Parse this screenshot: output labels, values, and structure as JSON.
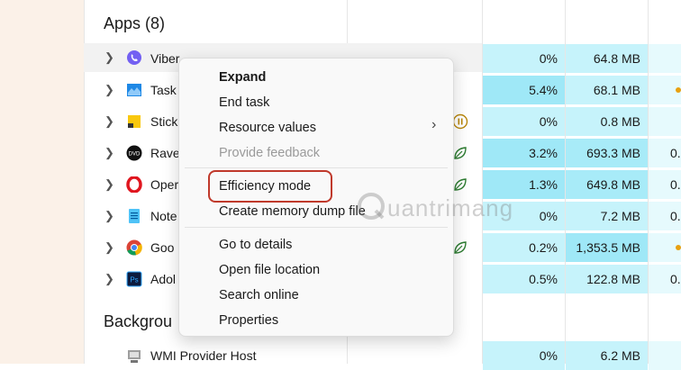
{
  "sections": {
    "apps_title": "Apps (8)",
    "background_title": "Backgrou"
  },
  "rows": [
    {
      "name": "Viber",
      "cpu": "0%",
      "mem": "64.8 MB",
      "extra": ""
    },
    {
      "name": "Task",
      "cpu": "5.4%",
      "mem": "68.1 MB",
      "extra": ""
    },
    {
      "name": "Stick",
      "cpu": "0%",
      "mem": "0.8 MB",
      "extra": ""
    },
    {
      "name": "Rave",
      "cpu": "3.2%",
      "mem": "693.3 MB",
      "extra": "0."
    },
    {
      "name": "Oper",
      "cpu": "1.3%",
      "mem": "649.8 MB",
      "extra": "0."
    },
    {
      "name": "Note",
      "cpu": "0%",
      "mem": "7.2 MB",
      "extra": "0."
    },
    {
      "name": "Goo",
      "cpu": "0.2%",
      "mem": "1,353.5 MB",
      "extra": ""
    },
    {
      "name": "Adol",
      "cpu": "0.5%",
      "mem": "122.8 MB",
      "extra": "0."
    }
  ],
  "background_rows": [
    {
      "name": "WMI Provider Host",
      "cpu": "0%",
      "mem": "6.2 MB",
      "extra": ""
    }
  ],
  "context_menu": {
    "items": [
      "Expand",
      "End task",
      "Resource values",
      "Provide feedback",
      "Efficiency mode",
      "Create memory dump file",
      "Go to details",
      "Open file location",
      "Search online",
      "Properties"
    ],
    "submenu_arrow": "›"
  },
  "watermark": "uantrimang",
  "colors": {
    "cpu_light": "#c6f3fb",
    "cpu_mid": "#9fe8f7",
    "mem_light": "#c6f3fb",
    "mem_mid": "#a8ebf8",
    "highlight": "#c0392b",
    "leaf": "#2e7d32",
    "pause": "#b8860b"
  }
}
